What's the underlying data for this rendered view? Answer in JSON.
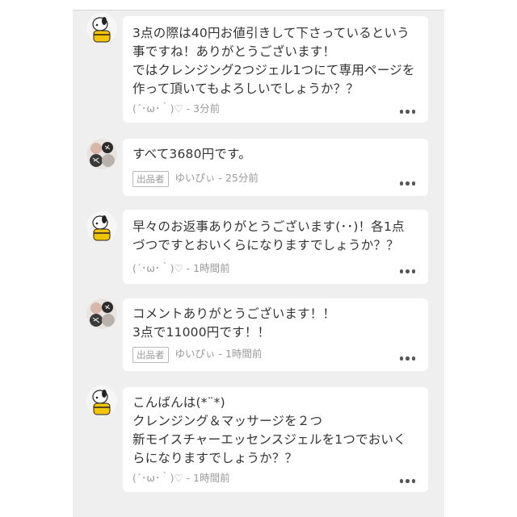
{
  "comments": [
    {
      "author_role": "buyer",
      "avatar_icon": "snoopy-avatar-icon",
      "text": "3点の際は40円お値引きして下さっているという\n事ですね！ありがとうございます！\nではクレンジング2つジェル1つにて専用ページを\n作って頂いてもよろしいでしょうか？？",
      "badge": "",
      "user": "(´･ω･｀)♡",
      "time": "3分前"
    },
    {
      "author_role": "seller",
      "avatar_icon": "pattern-avatar-icon",
      "text": "すべて3680円です。",
      "badge": "出品者",
      "user": "ゆいぴぃ",
      "time": "25分前"
    },
    {
      "author_role": "buyer",
      "avatar_icon": "snoopy-avatar-icon",
      "text": "早々のお返事ありがとうございます(･･)！各1点\nづつですとおいくらになりますでしょうか？？",
      "badge": "",
      "user": "(´･ω･｀)♡",
      "time": "1時間前"
    },
    {
      "author_role": "seller",
      "avatar_icon": "pattern-avatar-icon",
      "text": "コメントありがとうございます！！\n3点で11000円です！！",
      "badge": "出品者",
      "user": "ゆいぴぃ",
      "time": "1時間前"
    },
    {
      "author_role": "buyer",
      "avatar_icon": "snoopy-avatar-icon",
      "text": "こんばんは(*¨*)\nクレンジング＆マッサージを２つ\n新モイスチャーエッセンスジェルを1つでおいく\nらになりますでしょうか？？",
      "badge": "",
      "user": "(´･ω･｀)♡",
      "time": "1時間前"
    }
  ],
  "meta_separator": " - ",
  "colors": {
    "panel": "#efefef",
    "bubble": "#ffffff",
    "text": "#333333",
    "meta": "#9a9a9a"
  }
}
